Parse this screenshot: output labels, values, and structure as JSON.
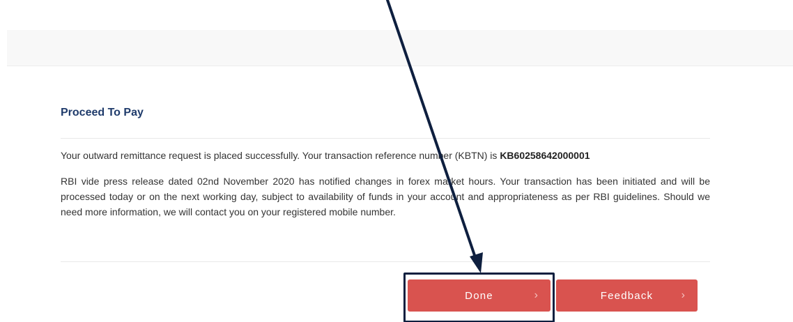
{
  "proceed": {
    "title": "Proceed To Pay",
    "success_text": "Your outward remittance request is placed successfully. Your transaction reference number (KBTN) is ",
    "reference_number": "KB60258642000001",
    "notice_text": "RBI vide press release dated 02nd November 2020 has notified changes in forex market hours. Your transaction has been initiated and will be processed today or on the next working day, subject to availability of funds in your account and appropriateness as per RBI guidelines. Should we need more information, we will contact you on your registered mobile number."
  },
  "buttons": {
    "done_label": "Done",
    "feedback_label": "Feedback",
    "chevron": "›"
  },
  "colors": {
    "primary_button": "#d9534f",
    "title": "#1f3b6b",
    "annotation": "#0e1f3f"
  },
  "icons": {
    "button_chevron": "chevron-right-icon"
  }
}
